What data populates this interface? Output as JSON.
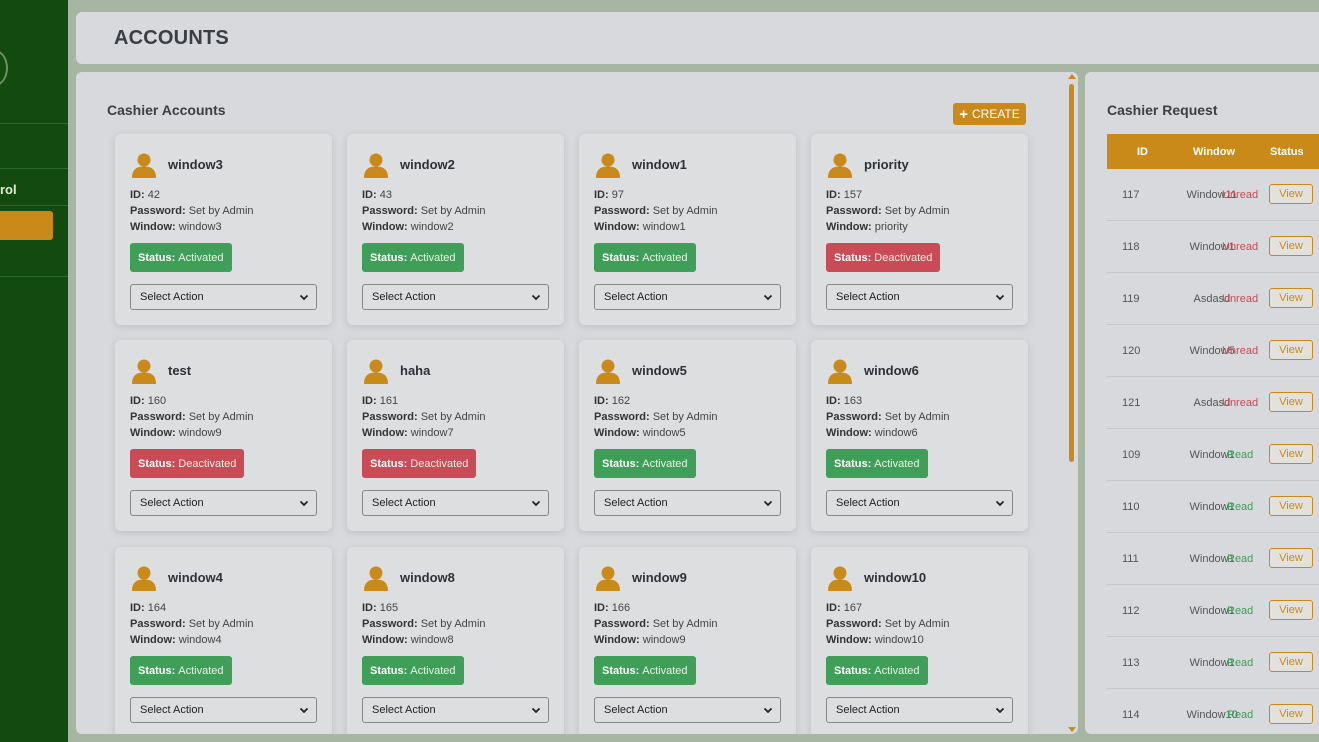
{
  "sidebar": {
    "nav_label": "rol"
  },
  "header": {
    "title": "ACCOUNTS"
  },
  "main": {
    "title": "Cashier Accounts",
    "create_label": "CREATE",
    "status_prefix": "Status:",
    "id_label": "ID:",
    "password_label": "Password:",
    "window_label": "Window:",
    "select_placeholder": "Select Action",
    "accounts": [
      {
        "name": "window3",
        "id": "42",
        "password": "Set by Admin",
        "window": "window3",
        "status": "Activated"
      },
      {
        "name": "window2",
        "id": "43",
        "password": "Set by Admin",
        "window": "window2",
        "status": "Activated"
      },
      {
        "name": "window1",
        "id": "97",
        "password": "Set by Admin",
        "window": "window1",
        "status": "Activated"
      },
      {
        "name": "priority",
        "id": "157",
        "password": "Set by Admin",
        "window": "priority",
        "status": "Deactivated"
      },
      {
        "name": "test",
        "id": "160",
        "password": "Set by Admin",
        "window": "window9",
        "status": "Deactivated"
      },
      {
        "name": "haha",
        "id": "161",
        "password": "Set by Admin",
        "window": "window7",
        "status": "Deactivated"
      },
      {
        "name": "window5",
        "id": "162",
        "password": "Set by Admin",
        "window": "window5",
        "status": "Activated"
      },
      {
        "name": "window6",
        "id": "163",
        "password": "Set by Admin",
        "window": "window6",
        "status": "Activated"
      },
      {
        "name": "window4",
        "id": "164",
        "password": "Set by Admin",
        "window": "window4",
        "status": "Activated"
      },
      {
        "name": "window8",
        "id": "165",
        "password": "Set by Admin",
        "window": "window8",
        "status": "Activated"
      },
      {
        "name": "window9",
        "id": "166",
        "password": "Set by Admin",
        "window": "window9",
        "status": "Activated"
      },
      {
        "name": "window10",
        "id": "167",
        "password": "Set by Admin",
        "window": "window10",
        "status": "Activated"
      }
    ]
  },
  "requests": {
    "title": "Cashier Request",
    "columns": [
      "ID",
      "Window",
      "Status"
    ],
    "view_label": "View",
    "rows": [
      {
        "id": "117",
        "window": "Window11",
        "status": "Unread"
      },
      {
        "id": "118",
        "window": "Window1",
        "status": "Unread"
      },
      {
        "id": "119",
        "window": "Asdasd",
        "status": "Unread"
      },
      {
        "id": "120",
        "window": "Window5",
        "status": "Unread"
      },
      {
        "id": "121",
        "window": "Asdasd",
        "status": "Unread"
      },
      {
        "id": "109",
        "window": "Window1",
        "status": "Read"
      },
      {
        "id": "110",
        "window": "Window1",
        "status": "Read"
      },
      {
        "id": "111",
        "window": "Window1",
        "status": "Read"
      },
      {
        "id": "112",
        "window": "Window1",
        "status": "Read"
      },
      {
        "id": "113",
        "window": "Window1",
        "status": "Read"
      },
      {
        "id": "114",
        "window": "Window10",
        "status": "Read"
      }
    ]
  },
  "colors": {
    "accent": "#c98a1a",
    "sidebar": "#124a10",
    "activated": "#3f9e57",
    "deactivated": "#c94b55"
  }
}
